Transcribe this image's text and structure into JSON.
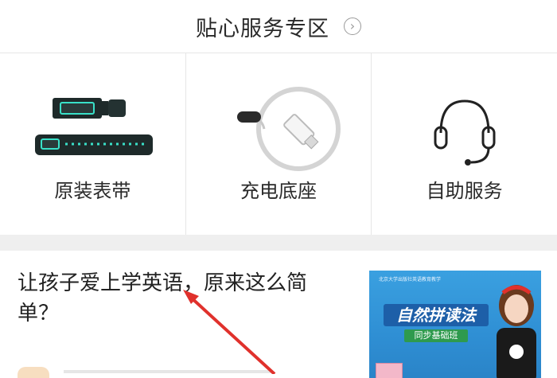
{
  "section": {
    "title": "贴心服务专区",
    "arrow_glyph": "›"
  },
  "services": [
    {
      "label": "原装表带",
      "icon": "watch-strap-icon"
    },
    {
      "label": "充电底座",
      "icon": "charging-cable-icon"
    },
    {
      "label": "自助服务",
      "icon": "headset-icon"
    }
  ],
  "article": {
    "title": "让孩子爱上学英语，原来这么简单？",
    "thumbnail": {
      "top_text": "北京大学出版社英语教育教学",
      "headline": "自然拼读法",
      "subtitle": "同步基础班"
    }
  },
  "colors": {
    "annotation_arrow": "#e0312c",
    "divider": "#efefef",
    "accent_cyan": "#39e0c8"
  }
}
